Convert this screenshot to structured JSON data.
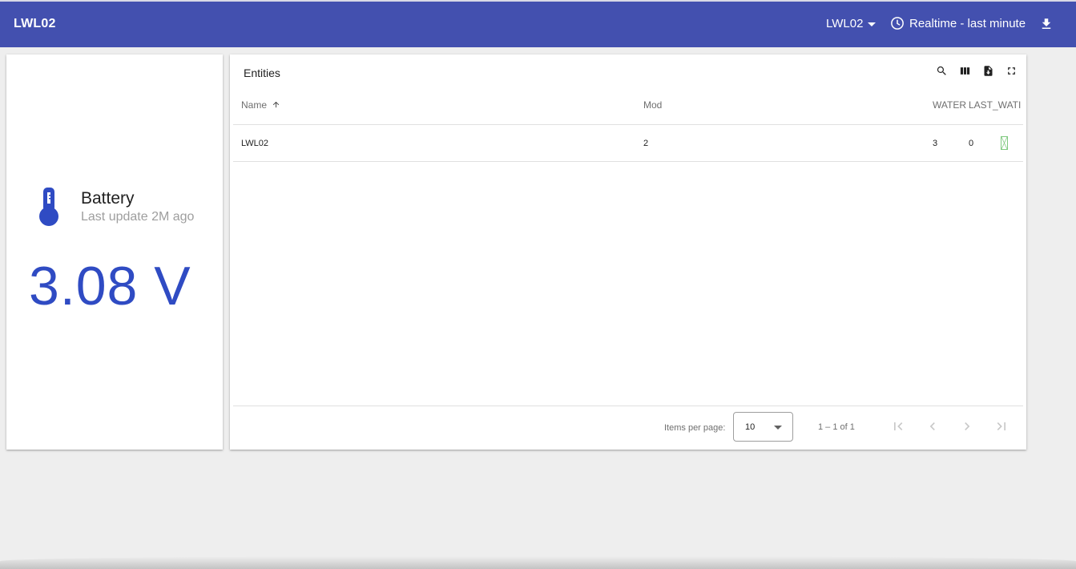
{
  "toolbar": {
    "title": "LWL02",
    "entity": "LWL02",
    "timewindow": "Realtime - last minute"
  },
  "battery": {
    "title": "Battery",
    "subtitle": "Last update 2M ago",
    "value": "3.08 V"
  },
  "entities_table": {
    "title": "Entities",
    "columns": [
      "Name",
      "Mod",
      "WATER",
      "LAST_WATI"
    ],
    "rows": [
      {
        "name": "LWL02",
        "mod": "2",
        "water": "3",
        "last_wati": "0"
      }
    ],
    "pagination": {
      "items_per_page_label": "Items per page:",
      "items_per_page": "10",
      "range": "1 – 1 of 1"
    }
  },
  "colors": {
    "toolbar": "#4350af",
    "accent": "#2f4bc3",
    "background": "#eeeeee"
  }
}
